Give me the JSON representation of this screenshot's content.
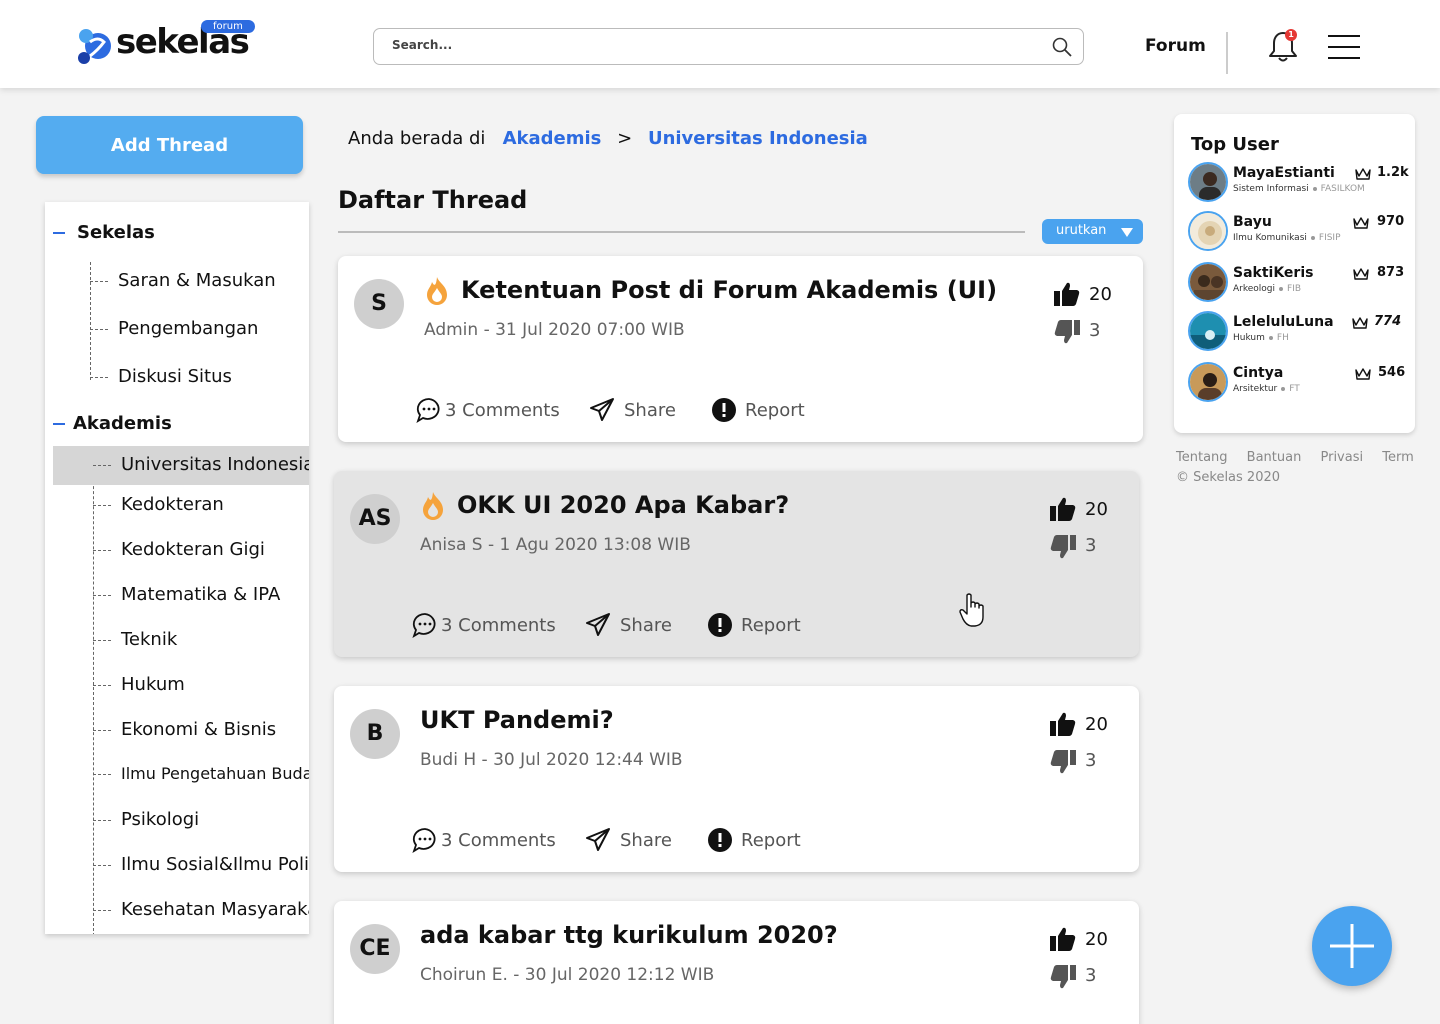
{
  "header": {
    "logo_text": "sekelas",
    "logo_badge": "forum",
    "search_placeholder": "Search...",
    "nav_forum": "Forum",
    "notification_count": "1"
  },
  "sidebar": {
    "add_thread_label": "Add Thread",
    "groups": [
      {
        "label": "Sekelas",
        "items": [
          "Saran & Masukan",
          "Pengembangan",
          "Diskusi Situs"
        ]
      },
      {
        "label": "Akademis",
        "items": [
          "Universitas Indonesia",
          "Kedokteran",
          "Kedokteran Gigi",
          "Matematika & IPA",
          "Teknik",
          "Hukum",
          "Ekonomi & Bisnis",
          "Ilmu Pengetahuan Budaya",
          "Psikologi",
          "Ilmu Sosial&Ilmu Politik",
          "Kesehatan Masyarakat"
        ]
      }
    ],
    "active_item": "Universitas Indonesia"
  },
  "breadcrumb": {
    "prefix": "Anda berada di",
    "level1": "Akademis",
    "separator": ">",
    "level2": "Universitas Indonesia"
  },
  "thread_list": {
    "title": "Daftar Thread",
    "sort_label": "urutkan",
    "threads": [
      {
        "initials": "S",
        "hot": true,
        "title": "Ketentuan Post di Forum Akademis (UI)",
        "meta": "Admin - 31 Jul 2020 07:00 WIB",
        "likes": "20",
        "dislikes": "3",
        "comments": "3 Comments",
        "share": "Share",
        "report": "Report"
      },
      {
        "initials": "AS",
        "hot": true,
        "title": "OKK UI 2020 Apa Kabar?",
        "meta": "Anisa S - 1 Agu 2020 13:08 WIB",
        "likes": "20",
        "dislikes": "3",
        "comments": "3 Comments",
        "share": "Share",
        "report": "Report"
      },
      {
        "initials": "B",
        "hot": false,
        "title": "UKT Pandemi?",
        "meta": "Budi H - 30 Jul 2020 12:44 WIB",
        "likes": "20",
        "dislikes": "3",
        "comments": "3 Comments",
        "share": "Share",
        "report": "Report"
      },
      {
        "initials": "CE",
        "hot": false,
        "title": "ada kabar ttg kurikulum 2020?",
        "meta": "Choirun E. - 30 Jul 2020 12:12 WIB",
        "likes": "20",
        "dislikes": "3"
      }
    ]
  },
  "top_user": {
    "title": "Top User",
    "users": [
      {
        "name": "MayaEstianti",
        "major": "Sistem Informasi",
        "faculty": "FASILKOM",
        "score": "1.2k"
      },
      {
        "name": "Bayu",
        "major": "Ilmu Komunikasi",
        "faculty": "FISIP",
        "score": "970"
      },
      {
        "name": "SaktiKeris",
        "major": "Arkeologi",
        "faculty": "FIB",
        "score": "873"
      },
      {
        "name": "LeleluluLuna",
        "major": "Hukum",
        "faculty": "FH",
        "score": "774"
      },
      {
        "name": "Cintya",
        "major": "Arsitektur",
        "faculty": "FT",
        "score": "546"
      }
    ]
  },
  "footer": {
    "links": [
      "Tentang",
      "Bantuan",
      "Privasi",
      "Term"
    ],
    "copyright": "© Sekelas 2020"
  },
  "colors": {
    "brand_blue": "#2d6be0",
    "accent_blue": "#4aa3ef",
    "fire_orange": "#f5a33c"
  }
}
